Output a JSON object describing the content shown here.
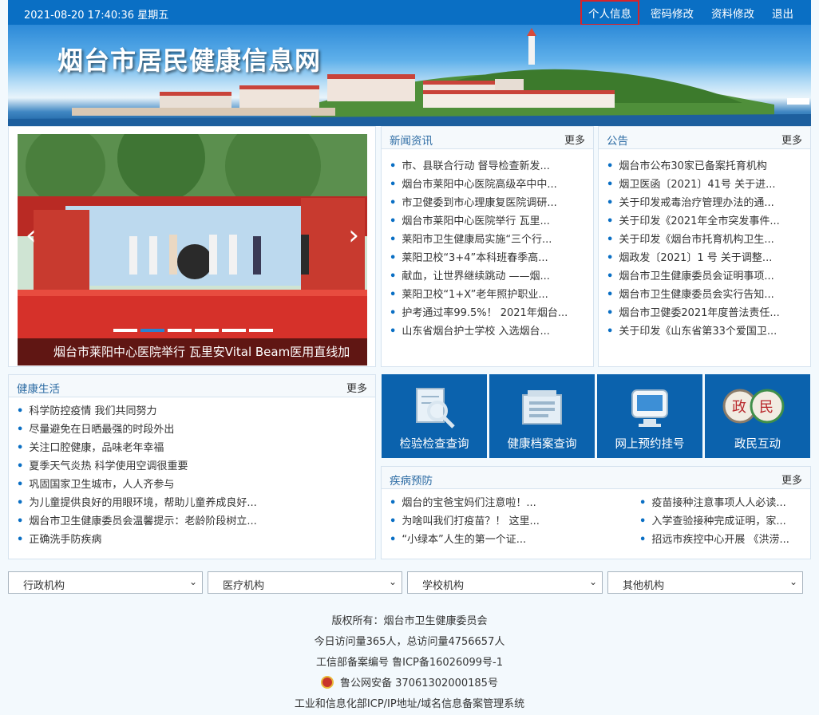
{
  "topbar": {
    "datetime": "2021-08-20 17:40:36 星期五",
    "links": [
      "个人信息",
      "密码修改",
      "资料修改",
      "退出"
    ]
  },
  "banner": {
    "title": "烟台市居民健康信息网"
  },
  "slider": {
    "caption": "烟台市莱阳中心医院举行 瓦里安Vital Beam医用直线加",
    "slides_count": 6,
    "active_slide": 2
  },
  "news": {
    "title": "新闻资讯",
    "more": "更多",
    "items": [
      "市、县联合行动 督导检查新发...",
      "烟台市莱阳中心医院高级卒中中...",
      "市卫健委到市心理康复医院调研...",
      "烟台市莱阳中心医院举行 瓦里...",
      "莱阳市卫生健康局实施“三个行...",
      "莱阳卫校“3+4”本科班春季高...",
      "献血，让世界继续跳动 ——烟...",
      "莱阳卫校“1+X”老年照护职业...",
      "护考通过率99.5%！ 2021年烟台...",
      "山东省烟台护士学校 入选烟台..."
    ]
  },
  "notice": {
    "title": "公告",
    "more": "更多",
    "items": [
      "烟台市公布30家已备案托育机构",
      "烟卫医函〔2021〕41号 关于进...",
      "关于印发戒毒治疗管理办法的通...",
      "关于印发《2021年全市突发事件...",
      "关于印发《烟台市托育机构卫生...",
      "烟政发〔2021〕1 号 关于调整...",
      "烟台市卫生健康委员会证明事项...",
      "烟台市卫生健康委员会实行告知...",
      "烟台市卫健委2021年度普法责任...",
      "关于印发《山东省第33个爱国卫..."
    ]
  },
  "health": {
    "title": "健康生活",
    "more": "更多",
    "items": [
      "科学防控疫情 我们共同努力",
      "尽量避免在日晒最强的时段外出",
      "关注口腔健康，品味老年幸福",
      "夏季天气炎热 科学使用空调很重要",
      "巩固国家卫生城市，人人齐参与",
      "为儿童提供良好的用眼环境，帮助儿童养成良好...",
      "烟台市卫生健康委员会温馨提示：老龄阶段树立...",
      "正确洗手防疾病"
    ]
  },
  "tiles": [
    {
      "label": "检验检查查询",
      "icon": "magnifier-doc-icon"
    },
    {
      "label": "健康档案查询",
      "icon": "folder-archive-icon"
    },
    {
      "label": "网上预约挂号",
      "icon": "monitor-icon"
    },
    {
      "label": "政民互动",
      "icon": "gov-people-icon"
    }
  ],
  "disease": {
    "title": "疾病预防",
    "more": "更多",
    "left_items": [
      "烟台的宝爸宝妈们注意啦！...",
      "为啥叫我们打疫苗？！ 这里...",
      "“小绿本”人生的第一个证..."
    ],
    "right_items": [
      "疫苗接种注意事项人人必读...",
      "入学查验接种完成证明，家...",
      "招远市疾控中心开展 《洪涝..."
    ]
  },
  "selects": [
    "行政机构",
    "医疗机构",
    "学校机构",
    "其他机构"
  ],
  "footer": {
    "copyright": "版权所有：烟台市卫生健康委员会",
    "visits": "今日访问量365人，总访问量4756657人",
    "icp": "工信部备案编号 鲁ICP备16026099号-1",
    "police": "鲁公网安备 37061302000185号",
    "system": "工业和信息化部ICP/IP地址/域名信息备案管理系统"
  },
  "colors": {
    "primary": "#0a6fc4",
    "tile": "#0b62ad",
    "highlight": "#d8232a"
  }
}
